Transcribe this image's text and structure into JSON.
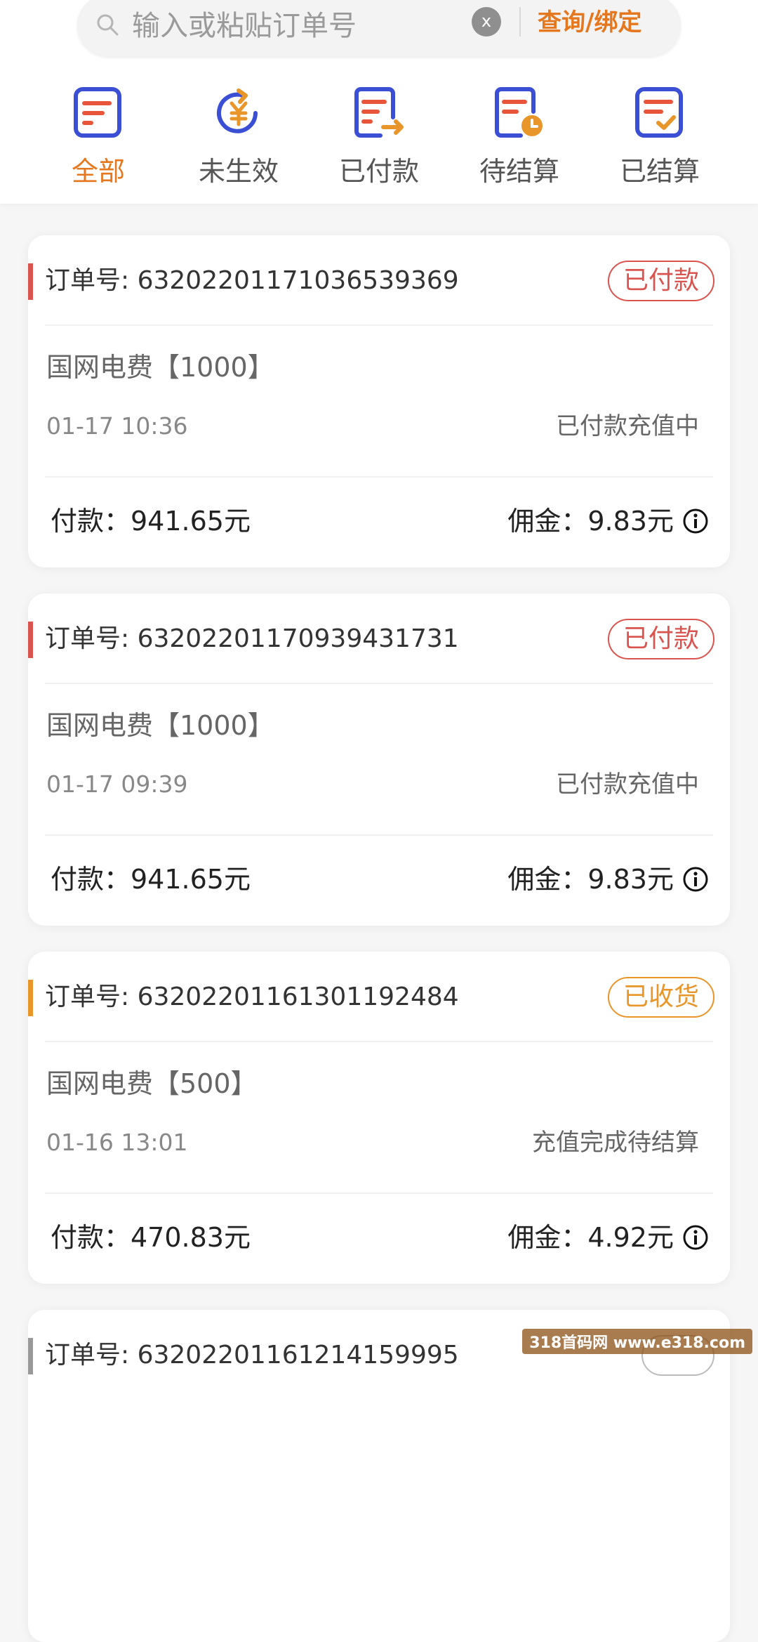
{
  "search": {
    "placeholder": "输入或粘贴订单号",
    "clear_label": "x",
    "query_label": "查询/绑定"
  },
  "tabs": [
    {
      "label": "全部",
      "icon": "list-icon",
      "active": true
    },
    {
      "label": "未生效",
      "icon": "yuan-refresh-icon",
      "active": false
    },
    {
      "label": "已付款",
      "icon": "list-arrow-icon",
      "active": false
    },
    {
      "label": "待结算",
      "icon": "list-clock-icon",
      "active": false
    },
    {
      "label": "已结算",
      "icon": "list-check-icon",
      "active": false
    }
  ],
  "colors": {
    "accent": "#e5771e",
    "paid_red": "#d9544f",
    "received_orange": "#e8952a",
    "gray": "#999999"
  },
  "orders": [
    {
      "order_label": "订单号: 632022011710365393​69",
      "status_badge": "已付款",
      "product": "国网电费【1000】",
      "time": "01-17 10:36",
      "status_text": "已付款充值中",
      "payment": "付款：941.65元",
      "commission": "佣金：9.83元"
    },
    {
      "order_label": "订单号: 632022011709394317​31",
      "status_badge": "已付款",
      "product": "国网电费【1000】",
      "time": "01-17 09:39",
      "status_text": "已付款充值中",
      "payment": "付款：941.65元",
      "commission": "佣金：9.83元"
    },
    {
      "order_label": "订单号: 632022011613011924​84",
      "status_badge": "已收货",
      "product": "国网电费【500】",
      "time": "01-16 13:01",
      "status_text": "充值完成待结算",
      "payment": "付款：470.83元",
      "commission": "佣金：4.92元"
    },
    {
      "order_label": "订单号: 632022011612141599​95",
      "status_badge": "",
      "product": "",
      "time": "",
      "status_text": "",
      "payment": "",
      "commission": ""
    }
  ],
  "watermark": "318首码网 www.e318.com"
}
